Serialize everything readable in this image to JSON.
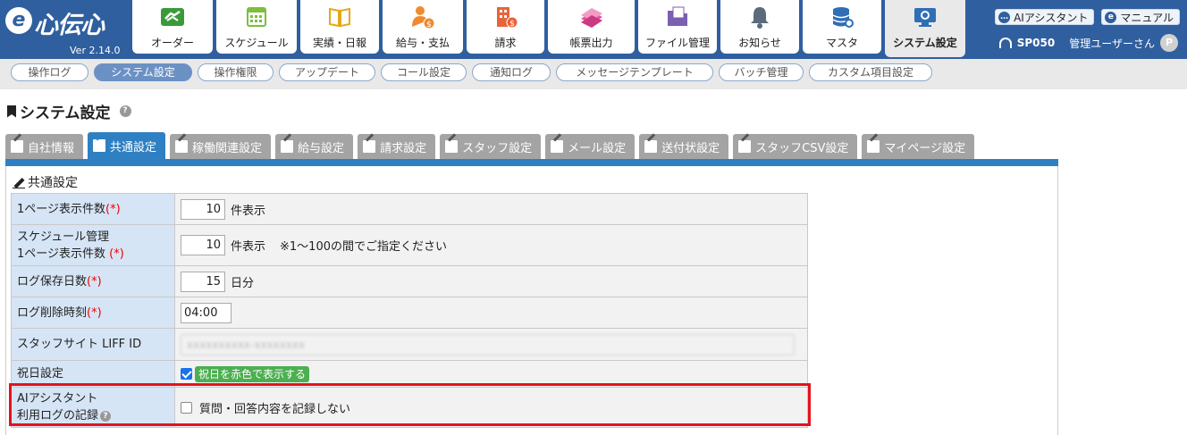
{
  "app": {
    "logo_mark": "e",
    "logo_text": "心伝心",
    "version": "Ver 2.14.0"
  },
  "mainnav": [
    {
      "label": "オーダー",
      "icon": "handshake-icon"
    },
    {
      "label": "スケジュール",
      "icon": "calendar-icon"
    },
    {
      "label": "実績・日報",
      "icon": "book-icon"
    },
    {
      "label": "給与・支払",
      "icon": "person-money-icon"
    },
    {
      "label": "請求",
      "icon": "building-money-icon"
    },
    {
      "label": "帳票出力",
      "icon": "papers-icon"
    },
    {
      "label": "ファイル管理",
      "icon": "folder-icon"
    },
    {
      "label": "お知らせ",
      "icon": "bell-icon"
    },
    {
      "label": "マスタ",
      "icon": "database-icon"
    },
    {
      "label": "システム設定",
      "icon": "monitor-gear-icon",
      "active": true
    }
  ],
  "header_right": {
    "ai_assistant": "AIアシスタント",
    "manual": "マニュアル",
    "user_code": "SP050",
    "user_name": "管理ユーザーさん",
    "avatar_letter": "P"
  },
  "subnav": [
    {
      "label": "操作ログ"
    },
    {
      "label": "システム設定",
      "active": true
    },
    {
      "label": "操作権限"
    },
    {
      "label": "アップデート"
    },
    {
      "label": "コール設定"
    },
    {
      "label": "通知ログ"
    },
    {
      "label": "メッセージテンプレート"
    },
    {
      "label": "バッチ管理"
    },
    {
      "label": "カスタム項目設定"
    }
  ],
  "page_title": "システム設定",
  "settings_tabs": [
    {
      "label": "自社情報"
    },
    {
      "label": "共通設定",
      "active": true
    },
    {
      "label": "稼働関連設定"
    },
    {
      "label": "給与設定"
    },
    {
      "label": "請求設定"
    },
    {
      "label": "スタッフ設定"
    },
    {
      "label": "メール設定"
    },
    {
      "label": "送付状設定"
    },
    {
      "label": "スタッフCSV設定"
    },
    {
      "label": "マイページ設定"
    }
  ],
  "section_title": "共通設定",
  "form": {
    "rows": {
      "page_count": {
        "label": "1ページ表示件数",
        "required": "(*)",
        "value": "10",
        "unit": "件表示"
      },
      "schedule_count": {
        "label_line1": "スケジュール管理",
        "label_line2": "1ページ表示件数",
        "required": "(*)",
        "value": "10",
        "unit": "件表示",
        "note": "※1～100の間でご指定ください"
      },
      "log_days": {
        "label": "ログ保存日数",
        "required": "(*)",
        "value": "15",
        "unit": "日分"
      },
      "log_delete_time": {
        "label": "ログ削除時刻",
        "required": "(*)",
        "value": "04:00"
      },
      "liff_id": {
        "label": "スタッフサイト LIFF ID",
        "value": "xxxxxxxxxx-xxxxxxxx"
      },
      "holiday": {
        "label": "祝日設定",
        "checked": true,
        "option": "祝日を赤色で表示する"
      },
      "ai_log": {
        "label_line1": "AIアシスタント",
        "label_line2": "利用ログの記録",
        "checked": false,
        "option": "質問・回答内容を記録しない"
      }
    }
  },
  "colors": {
    "header_blue": "#2f5f9f",
    "tab_active": "#2f80c2",
    "label_bg": "#d6e5f5",
    "highlight_red": "#e5121b",
    "badge_green": "#4caf50"
  }
}
